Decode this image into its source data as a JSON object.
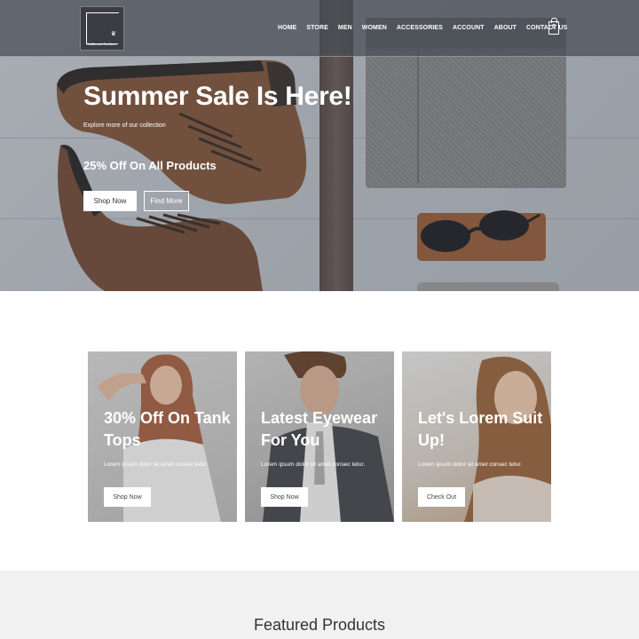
{
  "brand": {
    "logo_text": "California Fashion",
    "logo_mark": "crown-icon"
  },
  "nav": {
    "items": [
      "HOME",
      "STORE",
      "MEN",
      "WOMEN",
      "ACCESSORIES",
      "ACCOUNT",
      "ABOUT",
      "CONTACT US"
    ],
    "cart_count": "0",
    "cart_icon": "shopping-bag-icon"
  },
  "hero": {
    "title": "Summer Sale Is Here!",
    "subtitle": "Explore more of our collection",
    "offer": "25% Off On All Products",
    "primary_button": "Shop Now",
    "secondary_button": "Find More"
  },
  "promos": [
    {
      "title": "30% Off On Tank Tops",
      "text": "Lorem ipsum dolor sit amet consec tetur.",
      "button": "Shop Now"
    },
    {
      "title": "Latest Eyewear For You",
      "text": "Lorem ipsum dolor sit amet consec tetur.",
      "button": "Shop Now"
    },
    {
      "title": "Let's Lorem Suit Up!",
      "text": "Lorem ipsum dolor sit amet consec tetur.",
      "button": "Check Out"
    }
  ],
  "featured": {
    "title": "Featured Products"
  },
  "colors": {
    "nav_bg": "#464c54",
    "button_bg": "#ffffff",
    "section_bg": "#f1f1f1",
    "text_dark": "#333333"
  }
}
